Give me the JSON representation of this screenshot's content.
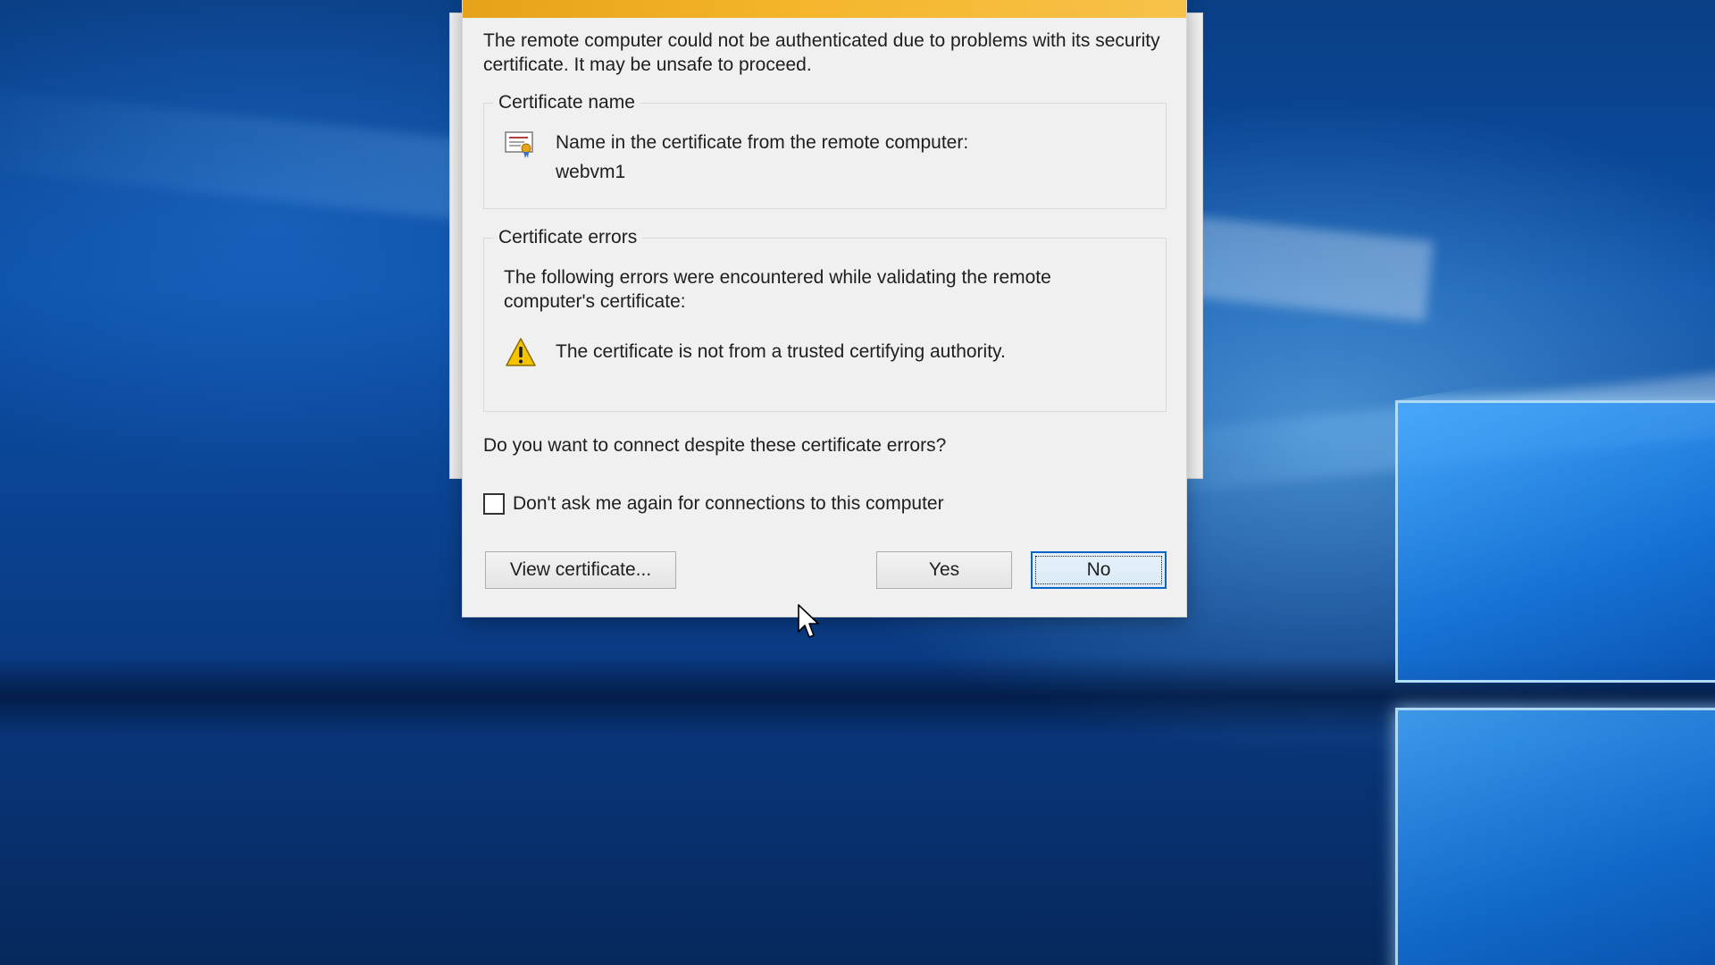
{
  "dialog": {
    "intro_text": "The remote computer could not be authenticated due to problems with its security certificate. It may be unsafe to proceed.",
    "cert_name_group": {
      "legend": "Certificate name",
      "label": "Name in the certificate from the remote computer:",
      "value": "webvm1",
      "icon": "certificate-icon"
    },
    "cert_errors_group": {
      "legend": "Certificate errors",
      "intro": "The following errors were encountered while validating the remote computer's certificate:",
      "errors": [
        {
          "icon": "warning-icon",
          "text": "The certificate is not from a trusted certifying authority."
        }
      ]
    },
    "question": "Do you want to connect despite these certificate errors?",
    "dont_ask_checkbox": {
      "label": "Don't ask me again for connections to this computer",
      "checked": false
    },
    "buttons": {
      "view_certificate": "View certificate...",
      "yes": "Yes",
      "no": "No"
    },
    "header_color": "#f4b52a",
    "focused_button_color": "#0a64c8"
  }
}
